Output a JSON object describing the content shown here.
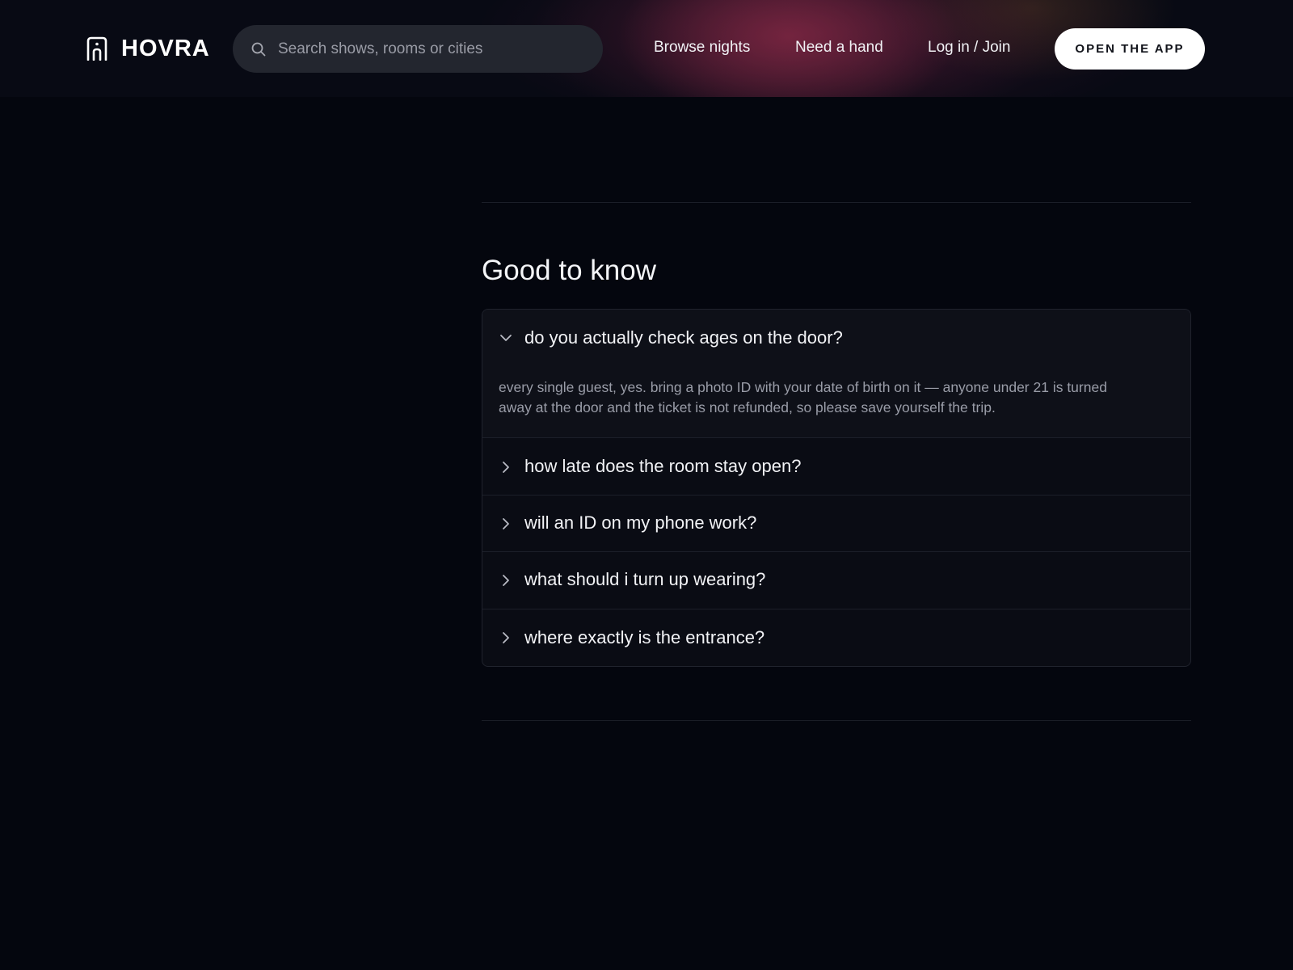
{
  "header": {
    "brand": "HOVRA",
    "search_placeholder": "Search shows, rooms or cities",
    "nav": [
      {
        "label": "Browse nights"
      },
      {
        "label": "Need a hand"
      },
      {
        "label": "Log in / Join"
      }
    ],
    "cta_label": "OPEN THE APP"
  },
  "colors": {
    "background": "#04060e",
    "glow": "#84284a",
    "cta_bg": "#ffffff"
  },
  "faq": {
    "title": "Good to know",
    "items": [
      {
        "question": "do you actually check ages on the door?",
        "answer": "every single guest, yes. bring a photo ID with your date of birth on it — anyone under 21 is turned away at the door and the ticket is not refunded, so please save yourself the trip.",
        "expanded": true
      },
      {
        "question": "how late does the room stay open?",
        "expanded": false
      },
      {
        "question": "will an ID on my phone work?",
        "expanded": false
      },
      {
        "question": "what should i turn up wearing?",
        "expanded": false
      },
      {
        "question": "where exactly is the entrance?",
        "expanded": false
      }
    ]
  }
}
